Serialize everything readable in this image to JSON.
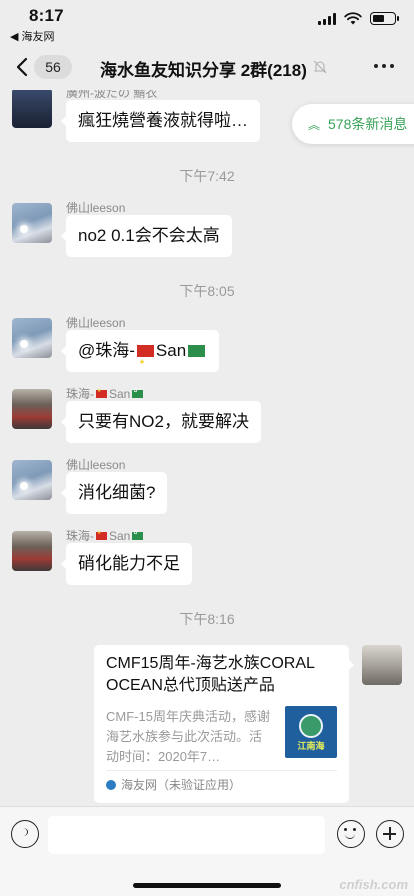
{
  "status_bar": {
    "time": "8:17",
    "back_app": "◀ 海友网"
  },
  "navbar": {
    "back_count": "56",
    "title": "海水鱼友知识分享 2群(218)"
  },
  "new_messages": {
    "label": "578条新消息"
  },
  "messages": [
    {
      "sender": "廣州-波だの 鯖衣",
      "text": "瘋狂燒營養液就得啦…"
    },
    {
      "timestamp": "下午7:42"
    },
    {
      "sender": "佛山leeson",
      "text": "no2 0.1会不会太高"
    },
    {
      "timestamp": "下午8:05"
    },
    {
      "sender": "佛山leeson",
      "text_prefix": "@珠海-",
      "text_suffix": "San"
    },
    {
      "sender_prefix": "珠海-",
      "sender_suffix": "San",
      "text": "只要有NO2，就要解决"
    },
    {
      "sender": "佛山leeson",
      "text": "消化细菌?"
    },
    {
      "sender_prefix": "珠海-",
      "sender_suffix": "San",
      "text": "硝化能力不足"
    },
    {
      "timestamp": "下午8:16"
    }
  ],
  "link_card": {
    "title": "CMF15周年-海艺水族CORAL OCEAN总代顶贴送产品",
    "description": "CMF-15周年庆典活动，感谢海艺水族参与此次活动。活动时间：2020年7…",
    "thumb_text": "江南海",
    "source": "海友网（未验证应用）"
  },
  "watermark": "cnfish.com"
}
